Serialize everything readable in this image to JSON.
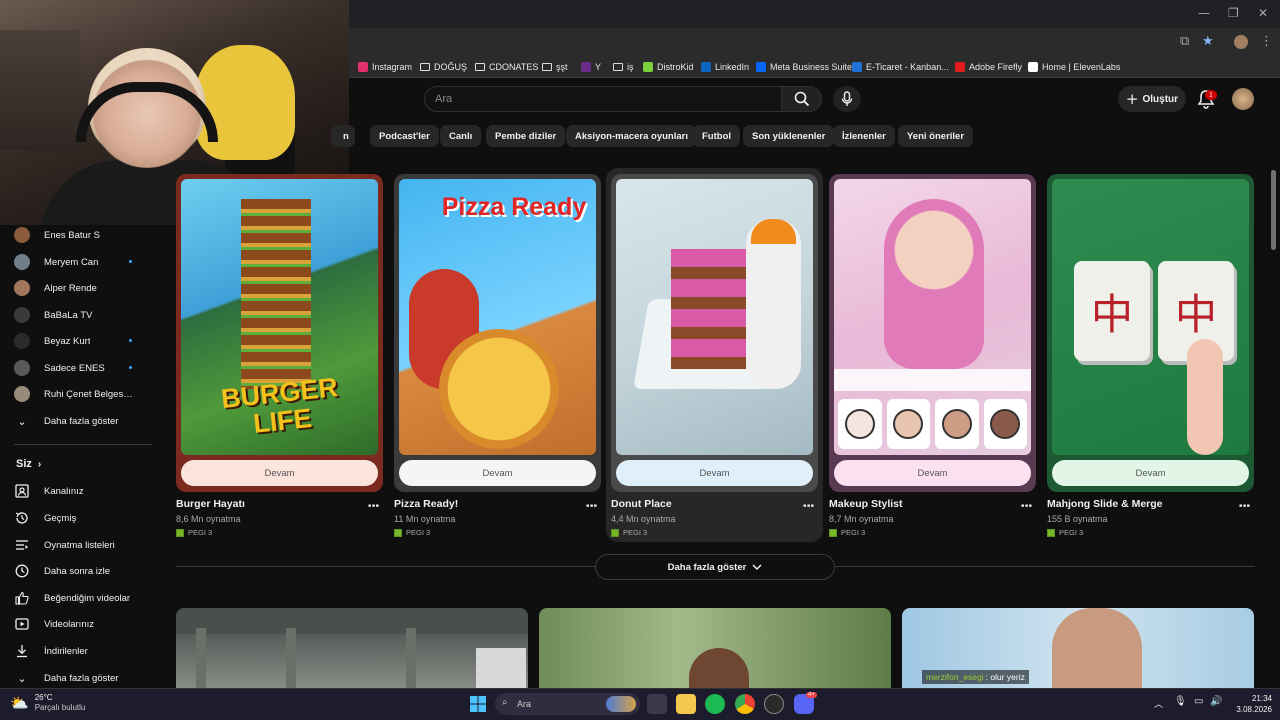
{
  "browser": {
    "window_controls": [
      "—",
      "❐",
      "✕"
    ],
    "bookmarks": [
      {
        "label": "Instagram",
        "color": "#e1306c"
      },
      {
        "label": "DOĞUŞ",
        "color": "folder"
      },
      {
        "label": "CDONATES",
        "color": "folder"
      },
      {
        "label": "şşt",
        "color": "folder"
      },
      {
        "label": "Y",
        "color": "#6b2d8a"
      },
      {
        "label": "iş",
        "color": "folder"
      },
      {
        "label": "DistroKid",
        "color": "#7ad03a"
      },
      {
        "label": "LinkedIn",
        "color": "#0a66c2"
      },
      {
        "label": "Meta Business Suite",
        "color": "#0866ff"
      },
      {
        "label": "E-Ticaret - Kanban...",
        "color": "#1e73d8"
      },
      {
        "label": "Adobe Firefly",
        "color": "#e21c1c"
      },
      {
        "label": "Home | ElevenLabs",
        "color": "#ffffff"
      }
    ]
  },
  "header": {
    "search_placeholder": "Ara",
    "create_label": "Oluştur",
    "notification_count": "1"
  },
  "chips": [
    "n",
    "Podcast'ler",
    "Canlı",
    "Pembe diziler",
    "Aksiyon-macera oyunları",
    "Futbol",
    "Son yüklenenler",
    "İzlenenler",
    "Yeni öneriler"
  ],
  "sidebar": {
    "subscriptions": [
      {
        "label": "Enes Batur S",
        "color": "#8a5a3a",
        "new": false
      },
      {
        "label": "Meryem Can",
        "color": "#6f7f8a",
        "new": true
      },
      {
        "label": "Alper Rende",
        "color": "#a0765a",
        "new": false
      },
      {
        "label": "BaBaLa TV",
        "color": "#3a3a3a",
        "new": false
      },
      {
        "label": "Beyaz Kurt",
        "color": "#2b2b2b",
        "new": true
      },
      {
        "label": "Sadece ENES",
        "color": "#5a5a5a",
        "new": true
      },
      {
        "label": "Ruhi Çenet Belgese...",
        "color": "#9a8a7a",
        "new": false
      }
    ],
    "show_more": "Daha fazla göster",
    "you_title": "Siz",
    "you_items": [
      {
        "label": "Kanalınız",
        "icon": "channel-icon"
      },
      {
        "label": "Geçmiş",
        "icon": "history-icon"
      },
      {
        "label": "Oynatma listeleri",
        "icon": "playlists-icon"
      },
      {
        "label": "Daha sonra izle",
        "icon": "clock-icon"
      },
      {
        "label": "Beğendiğim videolar",
        "icon": "thumbs-up-icon"
      },
      {
        "label": "Videolarınız",
        "icon": "videos-icon"
      },
      {
        "label": "İndirilenler",
        "icon": "download-icon"
      }
    ],
    "you_show_more": "Daha fazla göster"
  },
  "games": [
    {
      "title": "Burger Hayatı",
      "plays": "8,6 Mn oynatma",
      "rating": "PEGI 3",
      "cta": "Devam",
      "art_text": "BURGER LIFE",
      "frame": "#7a2a1e",
      "btn": "#fbe4dc"
    },
    {
      "title": "Pizza Ready!",
      "plays": "11 Mn oynatma",
      "rating": "PEGI 3",
      "cta": "Devam",
      "art_text": "Pizza Ready",
      "frame": "#3a3a3a",
      "btn": "#f5f5f5"
    },
    {
      "title": "Donut Place",
      "plays": "4,4 Mn oynatma",
      "rating": "PEGI 3",
      "cta": "Devam",
      "art_text": "",
      "frame": "#4a4a4a",
      "btn": "#dff0fa"
    },
    {
      "title": "Makeup Stylist",
      "plays": "8,7 Mn oynatma",
      "rating": "PEGI 3",
      "cta": "Devam",
      "art_text": "",
      "frame": "#5a3a52",
      "btn": "#fbe1ef"
    },
    {
      "title": "Mahjong Slide & Merge",
      "plays": "155 B oynatma",
      "rating": "PEGI 3",
      "cta": "Devam",
      "art_text": "中",
      "frame": "#1d5a34",
      "btn": "#e3f5e7"
    }
  ],
  "show_more_games": "Daha fazla göster",
  "video_overlay": {
    "channel": "merzifon_esegi",
    "text": ": olur yeriz"
  },
  "taskbar": {
    "weather_temp": "26°C",
    "weather_desc": "Parçalı bulutlu",
    "search_label": "Ara",
    "time": "21:34",
    "date": "3.08.2026",
    "discord_badge": "4+"
  },
  "colors": {
    "background": "#0f0f0f",
    "chip": "#272727",
    "accent": "#3ea6ff",
    "notification": "#cc0000"
  }
}
